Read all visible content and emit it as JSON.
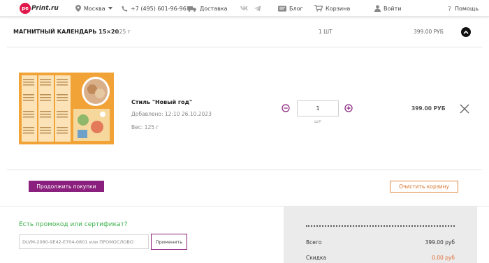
{
  "header": {
    "logo_badge": "pe",
    "logo_text": "Print.ru",
    "city": "Москва",
    "phone": "+7 (495) 601-96-96",
    "delivery": "Доставка",
    "blog": "Блог",
    "cart": "Корзина",
    "login": "Войти",
    "help": "Помощь"
  },
  "product": {
    "name": "МАГНИТНЫЙ КАЛЕНДАРЬ 15×20",
    "weight": "125 г",
    "quantity": "1 ШТ",
    "price": "399.00 РУБ"
  },
  "item": {
    "title": "Стиль \"Новый год\"",
    "added": "Добавлено: 12:10 26.10.2023",
    "weight": "Вес: 125 г",
    "qty_value": "1",
    "qty_unit": "шт",
    "price": "399.00 РУБ"
  },
  "actions": {
    "continue": "Продолжить покупки",
    "clear": "Очистить корзину"
  },
  "promo": {
    "title": "Есть промокод или сертификат?",
    "placeholder": "DLVM-2080-9E42-E704-0801 или ПРОМОСЛОВО",
    "apply": "Применить"
  },
  "summary": {
    "total_label": "Всего",
    "total_value": "399.00 руб",
    "discount_label": "Скидка",
    "discount_value": "0.00 руб"
  },
  "colors": {
    "brand": "#e0184b",
    "accent_purple": "#8a1f7d",
    "promo_green": "#3bb14a",
    "orange": "#d8742a"
  },
  "icons": [
    "location-icon",
    "phone-icon",
    "delivery-icon",
    "vk-icon",
    "telegram-icon",
    "blog-icon",
    "cart-icon",
    "user-icon",
    "help-icon",
    "chevron-up-icon",
    "minus-circle-icon",
    "plus-circle-icon",
    "close-icon"
  ]
}
